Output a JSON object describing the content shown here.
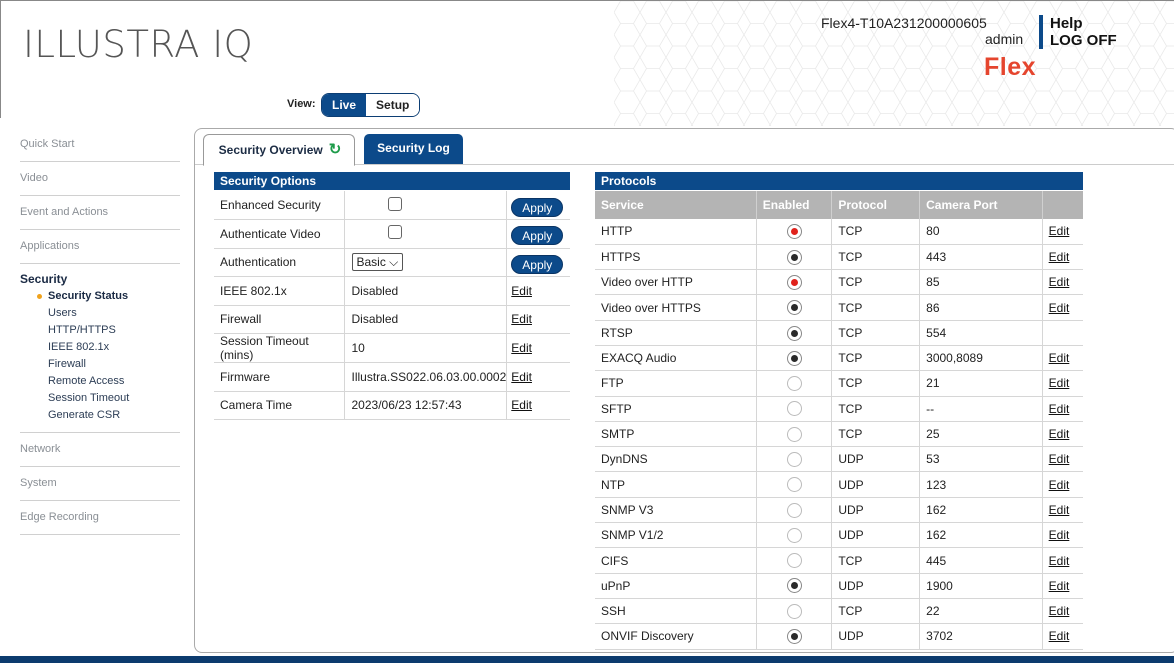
{
  "header": {
    "logo": "ILLUSTRA IQ",
    "view_label": "View:",
    "view_live": "Live",
    "view_setup": "Setup",
    "device_name": "Flex4-T10A231200000605",
    "user": "admin",
    "help": "Help",
    "logoff": "LOG OFF",
    "brand": "Flex",
    "brand_color": "#e5452e"
  },
  "sidebar": {
    "items": [
      {
        "label": "Quick Start"
      },
      {
        "label": "Video"
      },
      {
        "label": "Event and Actions"
      },
      {
        "label": "Applications"
      }
    ],
    "security": {
      "title": "Security",
      "subitems": [
        {
          "label": "Security Status",
          "active": true
        },
        {
          "label": "Users"
        },
        {
          "label": "HTTP/HTTPS"
        },
        {
          "label": "IEEE 802.1x"
        },
        {
          "label": "Firewall"
        },
        {
          "label": "Remote Access"
        },
        {
          "label": "Session Timeout"
        },
        {
          "label": "Generate CSR"
        }
      ]
    },
    "items_after": [
      {
        "label": "Network"
      },
      {
        "label": "System"
      },
      {
        "label": "Edge Recording"
      }
    ]
  },
  "tabs": {
    "overview": "Security Overview",
    "log": "Security Log"
  },
  "options": {
    "title": "Security Options",
    "apply_label": "Apply",
    "edit_label": "Edit",
    "rows": [
      {
        "label": "Enhanced Security",
        "type": "checkbox",
        "action": "apply"
      },
      {
        "label": "Authenticate Video",
        "type": "checkbox",
        "action": "apply"
      },
      {
        "label": "Authentication",
        "type": "select",
        "value": "Basic",
        "action": "apply"
      },
      {
        "label": "IEEE 802.1x",
        "value": "Disabled",
        "action": "edit"
      },
      {
        "label": "Firewall",
        "value": "Disabled",
        "action": "edit"
      },
      {
        "label": "Session Timeout (mins)",
        "value": "10",
        "action": "edit"
      },
      {
        "label": "Firmware",
        "value": "Illustra.SS022.06.03.00.0002",
        "action": "edit"
      },
      {
        "label": "Camera Time",
        "value": "2023/06/23 12:57:43",
        "action": "edit"
      }
    ]
  },
  "protocols": {
    "title": "Protocols",
    "columns": [
      "Service",
      "Enabled",
      "Protocol",
      "Camera Port",
      ""
    ],
    "edit_label": "Edit",
    "rows": [
      {
        "service": "HTTP",
        "enabled": "red",
        "protocol": "TCP",
        "port": "80",
        "edit": true
      },
      {
        "service": "HTTPS",
        "enabled": "black",
        "protocol": "TCP",
        "port": "443",
        "edit": true
      },
      {
        "service": "Video over HTTP",
        "enabled": "red",
        "protocol": "TCP",
        "port": "85",
        "edit": true
      },
      {
        "service": "Video over HTTPS",
        "enabled": "black",
        "protocol": "TCP",
        "port": "86",
        "edit": true
      },
      {
        "service": "RTSP",
        "enabled": "black",
        "protocol": "TCP",
        "port": "554",
        "edit": false
      },
      {
        "service": "EXACQ Audio",
        "enabled": "black",
        "protocol": "TCP",
        "port": "3000,8089",
        "edit": true
      },
      {
        "service": "FTP",
        "enabled": "empty",
        "protocol": "TCP",
        "port": "21",
        "edit": true
      },
      {
        "service": "SFTP",
        "enabled": "empty",
        "protocol": "TCP",
        "port": "--",
        "edit": true
      },
      {
        "service": "SMTP",
        "enabled": "empty",
        "protocol": "TCP",
        "port": "25",
        "edit": true
      },
      {
        "service": "DynDNS",
        "enabled": "empty",
        "protocol": "UDP",
        "port": "53",
        "edit": true
      },
      {
        "service": "NTP",
        "enabled": "empty",
        "protocol": "UDP",
        "port": "123",
        "edit": true
      },
      {
        "service": "SNMP V3",
        "enabled": "empty",
        "protocol": "UDP",
        "port": "162",
        "edit": true
      },
      {
        "service": "SNMP V1/2",
        "enabled": "empty",
        "protocol": "UDP",
        "port": "162",
        "edit": true
      },
      {
        "service": "CIFS",
        "enabled": "empty",
        "protocol": "TCP",
        "port": "445",
        "edit": true
      },
      {
        "service": "uPnP",
        "enabled": "black",
        "protocol": "UDP",
        "port": "1900",
        "edit": true
      },
      {
        "service": "SSH",
        "enabled": "empty",
        "protocol": "TCP",
        "port": "22",
        "edit": true
      },
      {
        "service": "ONVIF Discovery",
        "enabled": "black",
        "protocol": "UDP",
        "port": "3702",
        "edit": true
      }
    ]
  }
}
